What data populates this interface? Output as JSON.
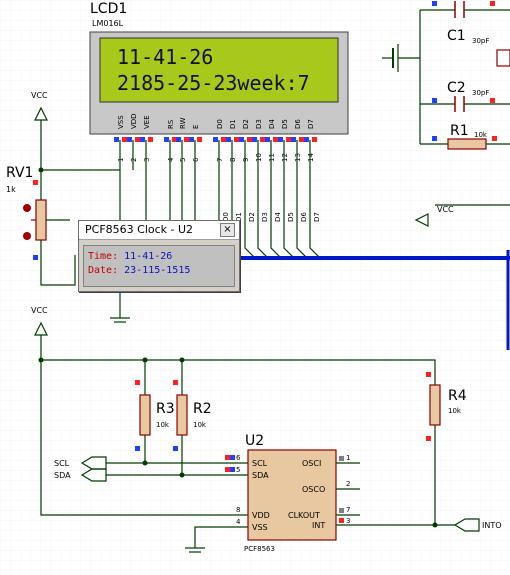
{
  "lcd": {
    "name": "LCD1",
    "model": "LM016L",
    "line1": "11-41-26",
    "line2": "2185-25-23week:7",
    "pin_names": [
      "VSS",
      "VDD",
      "VEE",
      "RS",
      "RW",
      "E",
      "D0",
      "D1",
      "D2",
      "D3",
      "D4",
      "D5",
      "D6",
      "D7"
    ],
    "pin_numbers": [
      "1",
      "2",
      "3",
      "4",
      "5",
      "6",
      "7",
      "8",
      "9",
      "10",
      "11",
      "12",
      "13",
      "14"
    ]
  },
  "bus_labels": [
    "D0",
    "D1",
    "D2",
    "D3",
    "D4",
    "D5",
    "D6",
    "D7"
  ],
  "rv1": {
    "name": "RV1",
    "value": "1k"
  },
  "power": {
    "vcc_1": "VCC",
    "vcc_2": "VCC",
    "vcc_3": "VCC"
  },
  "caps": {
    "c1": {
      "name": "C1",
      "value": "30pF"
    },
    "c2": {
      "name": "C2",
      "value": "30pF"
    }
  },
  "r1": {
    "name": "R1",
    "value": "10k"
  },
  "r2": {
    "name": "R2",
    "value": "10k"
  },
  "r3": {
    "name": "R3",
    "value": "10k"
  },
  "r4": {
    "name": "R4",
    "value": "10k"
  },
  "u2": {
    "name": "U2",
    "model": "PCF8563",
    "left_pins": [
      {
        "num": "6",
        "name": "SCL"
      },
      {
        "num": "5",
        "name": "SDA"
      },
      {
        "num": "8",
        "name": "VDD"
      },
      {
        "num": "4",
        "name": "VSS"
      }
    ],
    "right_pins": [
      {
        "num": "1",
        "name": "OSCI"
      },
      {
        "num": "2",
        "name": "OSCO"
      },
      {
        "num": "7",
        "name": "CLKOUT"
      },
      {
        "num": "3",
        "name": "INT"
      }
    ]
  },
  "terminals": {
    "scl": "SCL",
    "sda": "SDA",
    "into": "INTO"
  },
  "popup": {
    "title": "PCF8563 Clock - U2",
    "close": "×",
    "time_label": "Time:",
    "time_value": "11-41-26",
    "date_label": "Date:",
    "date_value": "23-115-1515"
  },
  "colors": {
    "bus": "#0018c8",
    "wire": "#003c00",
    "part": "#8b0000",
    "lcd_bg": "#a8c81c",
    "lcd_frame": "#c8c8c8",
    "pin_red": "#ff2020",
    "pin_blue": "#2040ff"
  }
}
